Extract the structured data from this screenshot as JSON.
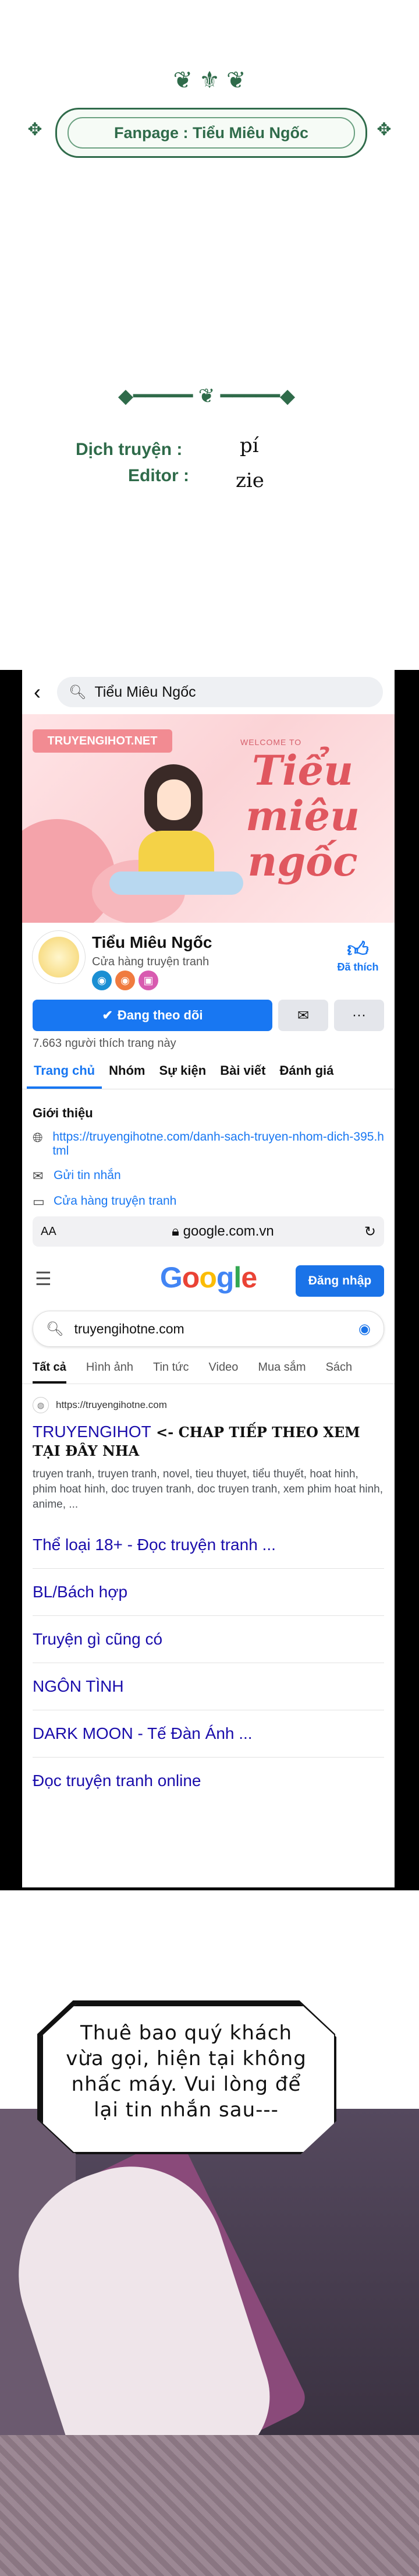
{
  "fanpage": {
    "label": "Fanpage : Tiểu Miêu Ngốc"
  },
  "credits": {
    "translator_label": "Dịch truyện :",
    "translator_value": "pí",
    "editor_label": "Editor :",
    "editor_value": "zie"
  },
  "facebook": {
    "search_text": "Tiểu Miêu Ngốc",
    "cover": {
      "site_tag": "TRUYENGIHOT.NET",
      "welcome_text": "WELCOME TO",
      "script_title": "Tiểu miêu ngốc"
    },
    "page": {
      "name": "Tiểu Miêu Ngốc",
      "category": "Cửa hàng truyện tranh",
      "liked_label": "Đã thích",
      "follow_label": "Đang theo dõi",
      "more_label": "···",
      "likes_count": "7.663 người thích trang này"
    },
    "tabs": [
      "Trang chủ",
      "Nhóm",
      "Sự kiện",
      "Bài viết",
      "Đánh giá"
    ],
    "intro": {
      "title": "Giới thiệu",
      "link": "https://truyengihotne.com/danh-sach-truyen-nhom-dich-395.html",
      "message": "Gửi tin nhắn",
      "category": "Cửa hàng truyện tranh"
    }
  },
  "browser": {
    "aa": "AA",
    "url": "google.com.vn"
  },
  "google": {
    "logo": "Google",
    "signin": "Đăng nhập",
    "query": "truyengihotne.com",
    "tabs": [
      "Tất cả",
      "Hình ảnh",
      "Tin tức",
      "Video",
      "Mua sắm",
      "Sách"
    ],
    "result": {
      "url": "https://truyengihotne.com",
      "title": "TRUYENGIHOT",
      "overlay": " <- CHAP TIẾP THEO XEM TẠI ĐÂY NHA",
      "snippet": "truyen tranh, truyen tranh, novel, tieu thuyet, tiểu thuyết, hoat hinh, phim hoat hinh, doc truyen tranh, doc truyen tranh, xem phim hoat hinh, anime, ..."
    },
    "sitelinks": [
      "Thể loại 18+ - Đọc truyện tranh ...",
      "BL/Bách hợp",
      "Truyện gì cũng có",
      "NGÔN TÌNH",
      "DARK MOON - Tế Đàn Ánh ...",
      "Đọc truyện tranh online"
    ]
  },
  "comic": {
    "speech": "Thuê bao quý khách vừa gọi, hiện tại không nhấc máy. Vui lòng để lại tin nhắn sau---"
  }
}
